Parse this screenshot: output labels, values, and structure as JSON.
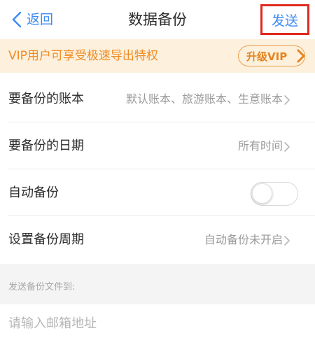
{
  "nav": {
    "back_label": "返回",
    "title": "数据备份",
    "send_label": "发送"
  },
  "vip": {
    "text": "VIP用户可享受极速导出特权",
    "button_label": "升级VIP"
  },
  "settings": {
    "books": {
      "label": "要备份的账本",
      "value": "默认账本、旅游账本、生意账本"
    },
    "date": {
      "label": "要备份的日期",
      "value": "所有时间"
    },
    "auto_backup": {
      "label": "自动备份",
      "enabled": false
    },
    "period": {
      "label": "设置备份周期",
      "value": "自动备份未开启"
    }
  },
  "send_section": {
    "header": "发送备份文件到:",
    "email_placeholder": "请输入邮箱地址",
    "email_value": ""
  },
  "icons": {
    "back": "chevron-left-icon",
    "vip_arrow": "chevron-right-icon",
    "row_arrow": "chevron-right-icon"
  },
  "colors": {
    "accent": "#3d8af2",
    "highlight_border": "#e02a1f",
    "vip_text": "#ee8c23",
    "vip_background": "#fdf0dc",
    "primary_text": "#2b2b2b",
    "secondary_text": "#9a9a9a"
  }
}
